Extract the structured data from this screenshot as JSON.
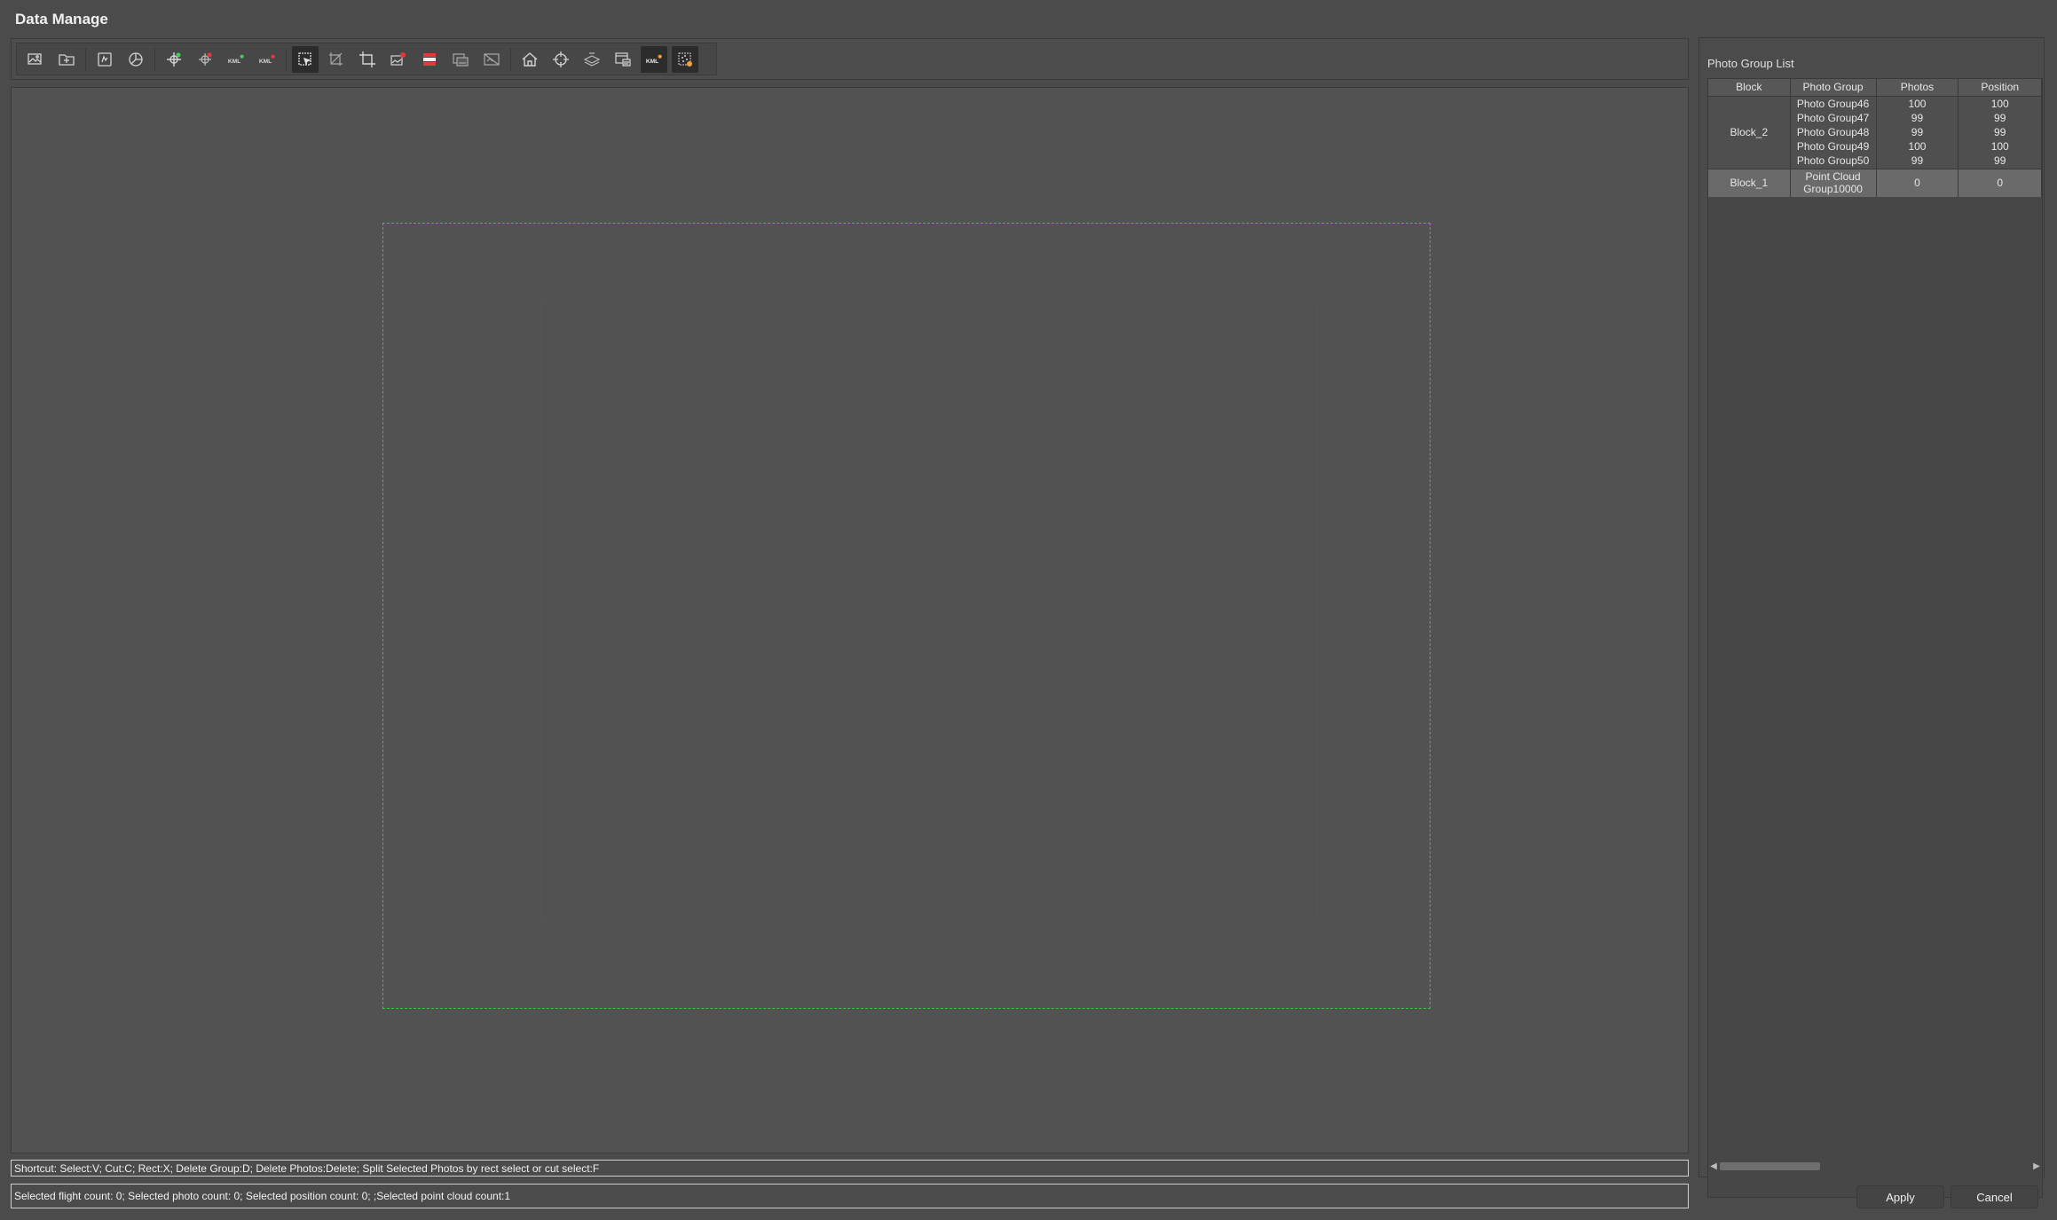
{
  "window": {
    "title": "Data Manage"
  },
  "toolbar": {
    "groups": [
      [
        {
          "icon": "import-photos-icon"
        },
        {
          "icon": "import-folder-icon"
        }
      ],
      [
        {
          "icon": "image-stats-icon"
        },
        {
          "icon": "pie-chart-icon"
        }
      ],
      [
        {
          "icon": "add-points-icon"
        },
        {
          "icon": "remove-points-icon"
        },
        {
          "icon": "kml-import-icon",
          "text": "KML"
        },
        {
          "icon": "kml-export-icon",
          "text": "KML"
        }
      ],
      [
        {
          "icon": "select-tool-icon",
          "active": true
        },
        {
          "icon": "cut-tool-icon"
        },
        {
          "icon": "crop-rect-icon"
        },
        {
          "icon": "delete-group-icon"
        },
        {
          "icon": "delete-photos-icon"
        },
        {
          "icon": "split-photos-icon"
        },
        {
          "icon": "merge-photos-icon"
        }
      ],
      [
        {
          "icon": "home-icon"
        },
        {
          "icon": "crosshair-icon"
        },
        {
          "icon": "layers-icon"
        },
        {
          "icon": "name-display-icon"
        },
        {
          "icon": "kml-show-icon",
          "text": "KML",
          "active": true
        },
        {
          "icon": "point-cloud-icon",
          "active": true
        }
      ]
    ],
    "colors": {
      "accent_red": "#e23a3a",
      "accent_green": "#3fcf5a",
      "icon": "#d4d4d4"
    }
  },
  "status": {
    "shortcuts": "Shortcut: Select:V; Cut:C; Rect:X; Delete Group:D; Delete Photos:Delete; Split Selected Photos by rect select or cut select:F",
    "counts": "Selected flight count: 0; Selected photo count: 0; Selected position count: 0; ;Selected point cloud count:1"
  },
  "panel": {
    "title": "Photo Group List",
    "columns": [
      "Block",
      "Photo Group",
      "Photos",
      "Position"
    ],
    "blocks": [
      {
        "name": "Block_2",
        "groups": [
          {
            "name": "Photo Group46",
            "photos": "100",
            "position": "100"
          },
          {
            "name": "Photo Group47",
            "photos": "99",
            "position": "99"
          },
          {
            "name": "Photo Group48",
            "photos": "99",
            "position": "99"
          },
          {
            "name": "Photo Group49",
            "photos": "100",
            "position": "100"
          },
          {
            "name": "Photo Group50",
            "photos": "99",
            "position": "99"
          }
        ]
      },
      {
        "name": "Block_1",
        "selected": true,
        "groups": [
          {
            "name_line1": "Point Cloud",
            "name_line2": "Group10000",
            "photos": "0",
            "position": "0"
          }
        ]
      }
    ],
    "scroll_left_icon": "chevron-left-icon",
    "scroll_right_icon": "chevron-right-icon"
  },
  "buttons": {
    "apply": "Apply",
    "cancel": "Cancel"
  },
  "canvas": {
    "selection_color": "#2ecc2e"
  }
}
